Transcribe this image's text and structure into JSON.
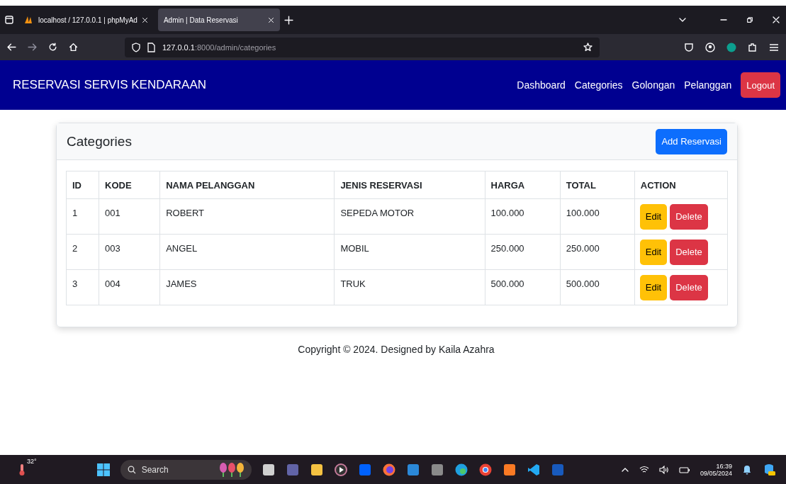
{
  "browser": {
    "tabs": [
      {
        "label": "localhost / 127.0.0.1 | phpMyAd",
        "selected": false
      },
      {
        "label": "Admin | Data Reservasi",
        "selected": true
      }
    ],
    "url_host": "127.0.0.1",
    "url_path": ":8000/admin/categories"
  },
  "navbar": {
    "brand": "RESERVASI SERVIS KENDARAAN",
    "links": [
      "Dashboard",
      "Categories",
      "Golongan",
      "Pelanggan"
    ],
    "logout": "Logout"
  },
  "card": {
    "title": "Categories",
    "add_button": "Add Reservasi",
    "table": {
      "columns": [
        "ID",
        "KODE",
        "NAMA PELANGGAN",
        "JENIS RESERVASI",
        "HARGA",
        "TOTAL",
        "ACTION"
      ],
      "rows": [
        {
          "cells": [
            "1",
            "001",
            "ROBERT",
            "SEPEDA MOTOR",
            "100.000",
            "100.000"
          ],
          "edit": "Edit",
          "delete": "Delete"
        },
        {
          "cells": [
            "2",
            "003",
            "ANGEL",
            "MOBIL",
            "250.000",
            "250.000"
          ],
          "edit": "Edit",
          "delete": "Delete"
        },
        {
          "cells": [
            "3",
            "004",
            "JAMES",
            "TRUK",
            "500.000",
            "500.000"
          ],
          "edit": "Edit",
          "delete": "Delete"
        }
      ]
    }
  },
  "footer": "Copyright © 2024. Designed by Kaila Azahra",
  "taskbar": {
    "weather": "32°",
    "search": "Search",
    "time": "16:39",
    "date": "09/05/2024"
  }
}
